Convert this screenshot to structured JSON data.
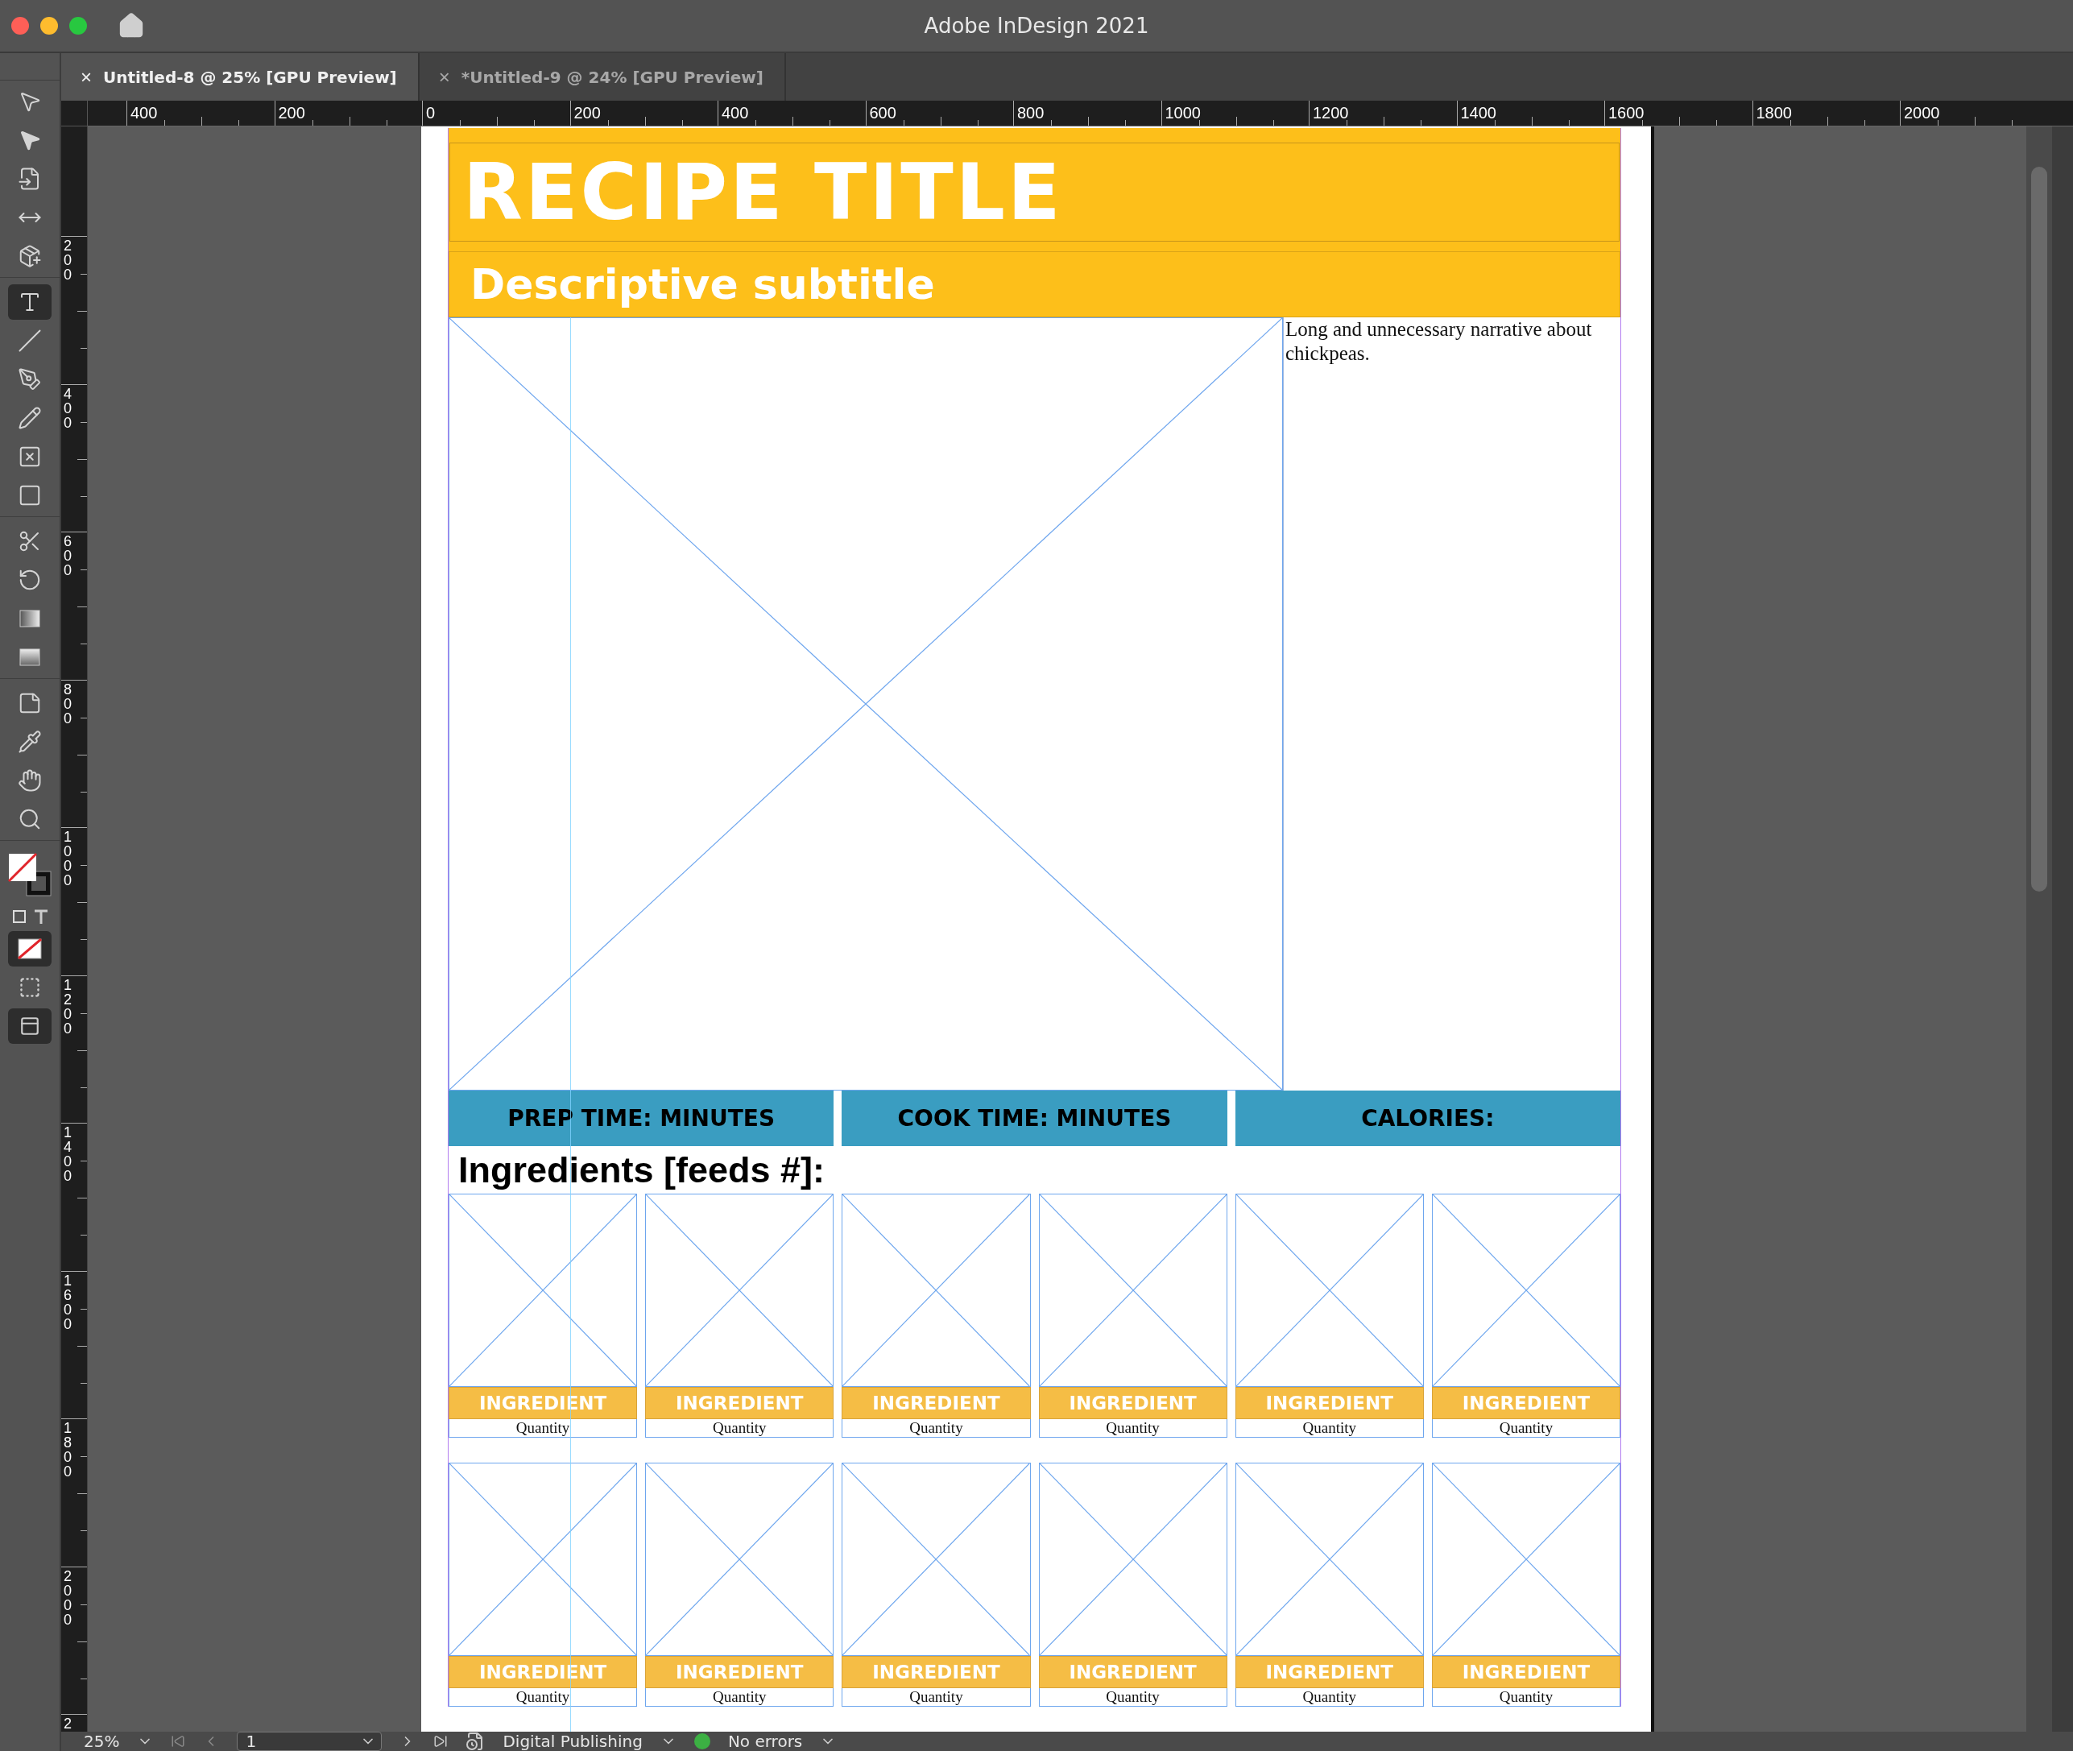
{
  "app_title": "Adobe InDesign 2021",
  "tabs": [
    {
      "close": "×",
      "label": "Untitled-8 @ 25% [GPU Preview]",
      "selected": true
    },
    {
      "close": "×",
      "label": "*Untitled-9 @ 24% [GPU Preview]",
      "selected": false
    }
  ],
  "tools": [
    {
      "kind": "selection",
      "selected": false
    },
    {
      "kind": "direct-selection",
      "selected": false
    },
    {
      "kind": "page",
      "selected": false
    },
    {
      "kind": "gap",
      "selected": false
    },
    {
      "kind": "content-collector",
      "selected": false
    },
    {
      "kind": "type",
      "selected": true
    },
    {
      "kind": "line",
      "selected": false
    },
    {
      "kind": "pen",
      "selected": false
    },
    {
      "kind": "pencil",
      "selected": false
    },
    {
      "kind": "frame",
      "selected": false
    },
    {
      "kind": "rectangle",
      "selected": false
    },
    {
      "kind": "scissors",
      "selected": false
    },
    {
      "kind": "rotate",
      "selected": false
    },
    {
      "kind": "gradient",
      "selected": false
    },
    {
      "kind": "feather",
      "selected": false
    },
    {
      "kind": "note",
      "selected": false
    },
    {
      "kind": "eyedropper",
      "selected": false
    },
    {
      "kind": "hand",
      "selected": false
    },
    {
      "kind": "zoom",
      "selected": false
    }
  ],
  "h_ruler": [
    "400",
    "200",
    "0",
    "200",
    "400",
    "600",
    "800",
    "1000",
    "1200",
    "1400",
    "1600",
    "1800",
    "2000"
  ],
  "v_ruler": [
    "200",
    "400",
    "600",
    "800",
    "1000",
    "1200",
    "1400",
    "1600",
    "1800",
    "2000",
    "2"
  ],
  "document": {
    "title": "RECIPE TITLE",
    "subtitle": "Descriptive subtitle",
    "narrative": "Long and unnecessary narrative about chickpeas.",
    "stats": [
      "PREP TIME: MINUTES",
      "COOK TIME: MINUTES",
      "CALORIES:"
    ],
    "ingredients_heading": "Ingredients [feeds #]:",
    "ingredients": [
      {
        "name": "INGREDIENT",
        "quantity": "Quantity"
      },
      {
        "name": "INGREDIENT",
        "quantity": "Quantity"
      },
      {
        "name": "INGREDIENT",
        "quantity": "Quantity"
      },
      {
        "name": "INGREDIENT",
        "quantity": "Quantity"
      },
      {
        "name": "INGREDIENT",
        "quantity": "Quantity"
      },
      {
        "name": "INGREDIENT",
        "quantity": "Quantity"
      },
      {
        "name": "INGREDIENT",
        "quantity": "Quantity"
      },
      {
        "name": "INGREDIENT",
        "quantity": "Quantity"
      },
      {
        "name": "INGREDIENT",
        "quantity": "Quantity"
      },
      {
        "name": "INGREDIENT",
        "quantity": "Quantity"
      },
      {
        "name": "INGREDIENT",
        "quantity": "Quantity"
      },
      {
        "name": "INGREDIENT",
        "quantity": "Quantity"
      }
    ]
  },
  "status_bar": {
    "zoom": "25%",
    "page": "1",
    "workspace": "Digital Publishing",
    "preflight": "No errors",
    "preflight_ok": true
  }
}
